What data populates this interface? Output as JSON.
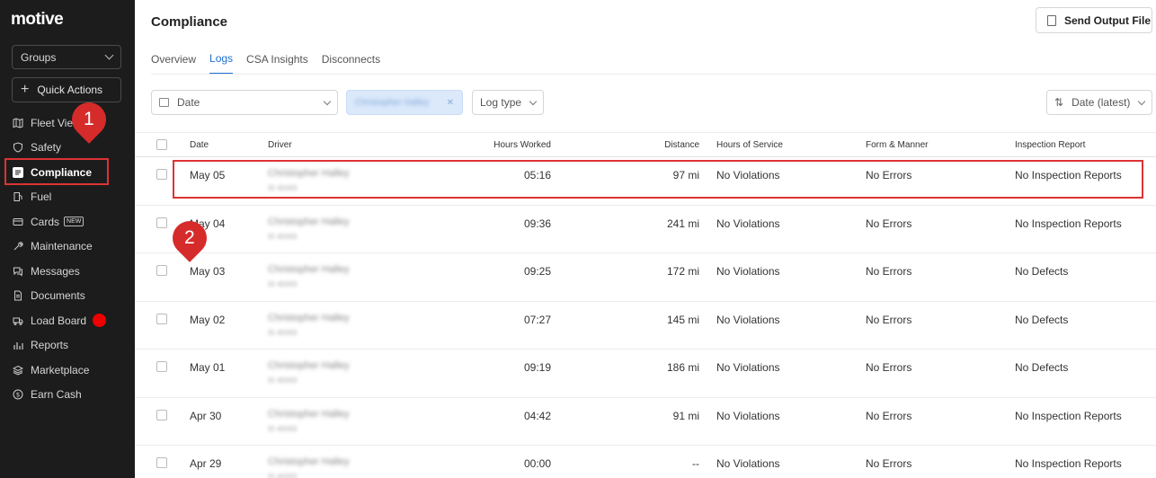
{
  "app": {
    "logo": "motive",
    "groups_label": "Groups",
    "quick_actions_label": "Quick Actions"
  },
  "sidebar": {
    "items": [
      {
        "label": "Fleet View",
        "icon": "map-icon"
      },
      {
        "label": "Safety",
        "icon": "shield-icon"
      },
      {
        "label": "Compliance",
        "icon": "document-icon",
        "active": true
      },
      {
        "label": "Fuel",
        "icon": "fuel-icon"
      },
      {
        "label": "Cards",
        "icon": "card-icon",
        "badge": "NEW"
      },
      {
        "label": "Maintenance",
        "icon": "wrench-icon"
      },
      {
        "label": "Messages",
        "icon": "chat-icon"
      },
      {
        "label": "Documents",
        "icon": "file-icon"
      },
      {
        "label": "Load Board",
        "icon": "truck-icon",
        "notification": true
      },
      {
        "label": "Reports",
        "icon": "chart-icon"
      },
      {
        "label": "Marketplace",
        "icon": "layers-icon"
      },
      {
        "label": "Earn Cash",
        "icon": "dollar-icon"
      }
    ]
  },
  "header": {
    "title": "Compliance",
    "send_output_label": "Send Output File"
  },
  "tabs": [
    {
      "label": "Overview"
    },
    {
      "label": "Logs",
      "active": true
    },
    {
      "label": "CSA Insights"
    },
    {
      "label": "Disconnects"
    }
  ],
  "filters": {
    "date_label": "Date",
    "driver_chip": "Christopher Halley",
    "log_type_label": "Log type",
    "sort_label": "Date (latest)"
  },
  "table": {
    "headers": {
      "date": "Date",
      "driver": "Driver",
      "hours": "Hours Worked",
      "distance": "Distance",
      "hos": "Hours of Service",
      "form": "Form & Manner",
      "inspection": "Inspection Report"
    },
    "rows": [
      {
        "date": "May 05",
        "driver": "Christopher Halley",
        "driver_id": "ID 40093",
        "hours": "05:16",
        "distance": "97 mi",
        "hos": "No Violations",
        "form": "No Errors",
        "inspection": "No Inspection Reports"
      },
      {
        "date": "May 04",
        "driver": "Christopher Halley",
        "driver_id": "ID 40093",
        "hours": "09:36",
        "distance": "241 mi",
        "hos": "No Violations",
        "form": "No Errors",
        "inspection": "No Inspection Reports"
      },
      {
        "date": "May 03",
        "driver": "Christopher Halley",
        "driver_id": "ID 40093",
        "hours": "09:25",
        "distance": "172 mi",
        "hos": "No Violations",
        "form": "No Errors",
        "inspection": "No Defects"
      },
      {
        "date": "May 02",
        "driver": "Christopher Halley",
        "driver_id": "ID 40093",
        "hours": "07:27",
        "distance": "145 mi",
        "hos": "No Violations",
        "form": "No Errors",
        "inspection": "No Defects"
      },
      {
        "date": "May 01",
        "driver": "Christopher Halley",
        "driver_id": "ID 40093",
        "hours": "09:19",
        "distance": "186 mi",
        "hos": "No Violations",
        "form": "No Errors",
        "inspection": "No Defects"
      },
      {
        "date": "Apr 30",
        "driver": "Christopher Halley",
        "driver_id": "ID 40093",
        "hours": "04:42",
        "distance": "91 mi",
        "hos": "No Violations",
        "form": "No Errors",
        "inspection": "No Inspection Reports"
      },
      {
        "date": "Apr 29",
        "driver": "Christopher Halley",
        "driver_id": "ID 40093",
        "hours": "00:00",
        "distance": "--",
        "hos": "No Violations",
        "form": "No Errors",
        "inspection": "No Inspection Reports"
      }
    ]
  },
  "annotations": {
    "marker_1": "1",
    "marker_2": "2",
    "color": "#d62b2b"
  }
}
